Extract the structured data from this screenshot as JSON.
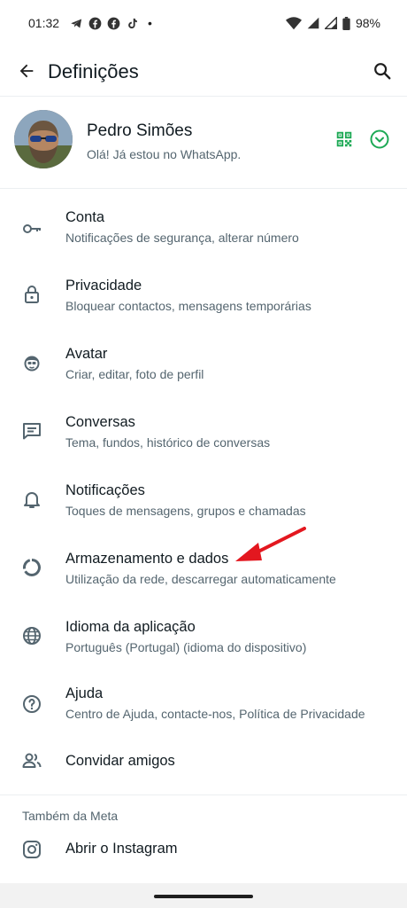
{
  "status_bar": {
    "time": "01:32",
    "battery": "98%",
    "notification_icons": [
      "telegram-icon",
      "facebook-icon",
      "facebook-icon",
      "tiktok-icon"
    ],
    "dot": "•"
  },
  "app_bar": {
    "title": "Definições"
  },
  "profile": {
    "name": "Pedro Simões",
    "status": "Olá! Já estou no WhatsApp."
  },
  "settings_items": [
    {
      "title": "Conta",
      "subtitle": "Notificações de segurança, alterar número",
      "icon": "key-icon"
    },
    {
      "title": "Privacidade",
      "subtitle": "Bloquear contactos, mensagens temporárias",
      "icon": "lock-icon"
    },
    {
      "title": "Avatar",
      "subtitle": "Criar, editar, foto de perfil",
      "icon": "avatar-face-icon"
    },
    {
      "title": "Conversas",
      "subtitle": "Tema, fundos, histórico de conversas",
      "icon": "chat-icon"
    },
    {
      "title": "Notificações",
      "subtitle": "Toques de mensagens, grupos e chamadas",
      "icon": "bell-icon"
    },
    {
      "title": "Armazenamento e dados",
      "subtitle": "Utilização da rede, descarregar automaticamente",
      "icon": "storage-circle-icon"
    },
    {
      "title": "Idioma da aplicação",
      "subtitle": "Português (Portugal) (idioma do dispositivo)",
      "icon": "globe-icon"
    },
    {
      "title": "Ajuda",
      "subtitle": "Centro de Ajuda, contacte-nos, Política de Privacidade",
      "icon": "help-icon"
    },
    {
      "title": "Convidar amigos",
      "icon": "people-icon"
    }
  ],
  "meta_section": {
    "label": "Também da Meta",
    "items": [
      {
        "title": "Abrir o Instagram",
        "icon": "instagram-icon"
      }
    ]
  },
  "colors": {
    "accent_green": "#1da955",
    "annotation_arrow": "#e3171f",
    "text_primary": "#111b21",
    "text_secondary": "#54656f"
  }
}
